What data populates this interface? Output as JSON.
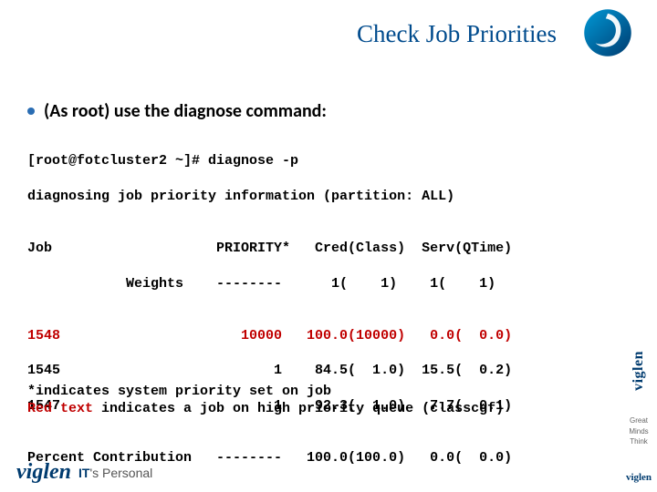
{
  "title": "Check Job Priorities",
  "bullet": "(As root) use the diagnose command:",
  "cmd_prompt": "[root@fotcluster2 ~]# diagnose -p",
  "cmd_line2": "diagnosing job priority information (partition: ALL)",
  "header1": "Job                    PRIORITY*   Cred(Class)  Serv(QTime)",
  "header2": "            Weights    --------      1(    1)    1(    1)",
  "blank": "",
  "row1": "1548                      10000   100.0(10000)   0.0(  0.0)",
  "row2": "1545                          1    84.5(  1.0)  15.5(  0.2)",
  "row3": "1547                          1    92.3(  1.0)   7.7(  0.1)",
  "pct": "Percent Contribution   --------   100.0(100.0)   0.0(  0.0)",
  "foot1": "*indicates system priority set on job",
  "foot2_red": "Red text",
  "foot2_rest": " indicates a job on high priority queue (classcgf)",
  "brand": "viglen",
  "tagline_it": "IT",
  "tagline_rest": "'s Personal",
  "side_labels": "Great\nMinds\nThink",
  "side_brand": "viglen"
}
